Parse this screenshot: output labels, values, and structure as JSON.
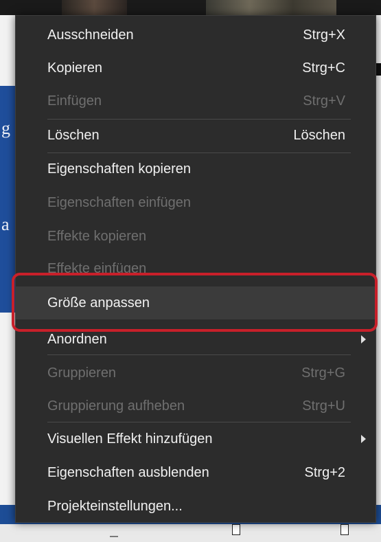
{
  "menu": {
    "items": [
      {
        "label": "Ausschneiden",
        "shortcut": "Strg+X"
      },
      {
        "label": "Kopieren",
        "shortcut": "Strg+C"
      },
      {
        "label": "Einfügen",
        "shortcut": "Strg+V",
        "disabled": true
      },
      {
        "label": "Löschen",
        "shortcut": "Löschen"
      },
      {
        "label": "Eigenschaften kopieren",
        "shortcut": ""
      },
      {
        "label": "Eigenschaften einfügen",
        "shortcut": "",
        "disabled": true
      },
      {
        "label": "Effekte kopieren",
        "shortcut": "",
        "disabled": true
      },
      {
        "label": "Effekte einfügen",
        "shortcut": "",
        "disabled": true
      },
      {
        "label": "Größe anpassen",
        "shortcut": "",
        "highlighted": true
      },
      {
        "label": "Anordnen",
        "shortcut": "",
        "submenu": true
      },
      {
        "label": "Gruppieren",
        "shortcut": "Strg+G",
        "disabled": true
      },
      {
        "label": "Gruppierung aufheben",
        "shortcut": "Strg+U",
        "disabled": true
      },
      {
        "label": "Visuellen Effekt hinzufügen",
        "shortcut": "",
        "submenu": true
      },
      {
        "label": "Eigenschaften ausblenden",
        "shortcut": "Strg+2"
      },
      {
        "label": "Projekteinstellungen...",
        "shortcut": ""
      }
    ]
  },
  "colors": {
    "menu_background": "#2c2c2c",
    "text_enabled": "#f1f1f1",
    "text_disabled": "#6f6f6f",
    "highlight_background": "#3b3b3b",
    "annotation_box": "#c8202a"
  },
  "background": {
    "side_letters": [
      "g",
      "a"
    ]
  }
}
